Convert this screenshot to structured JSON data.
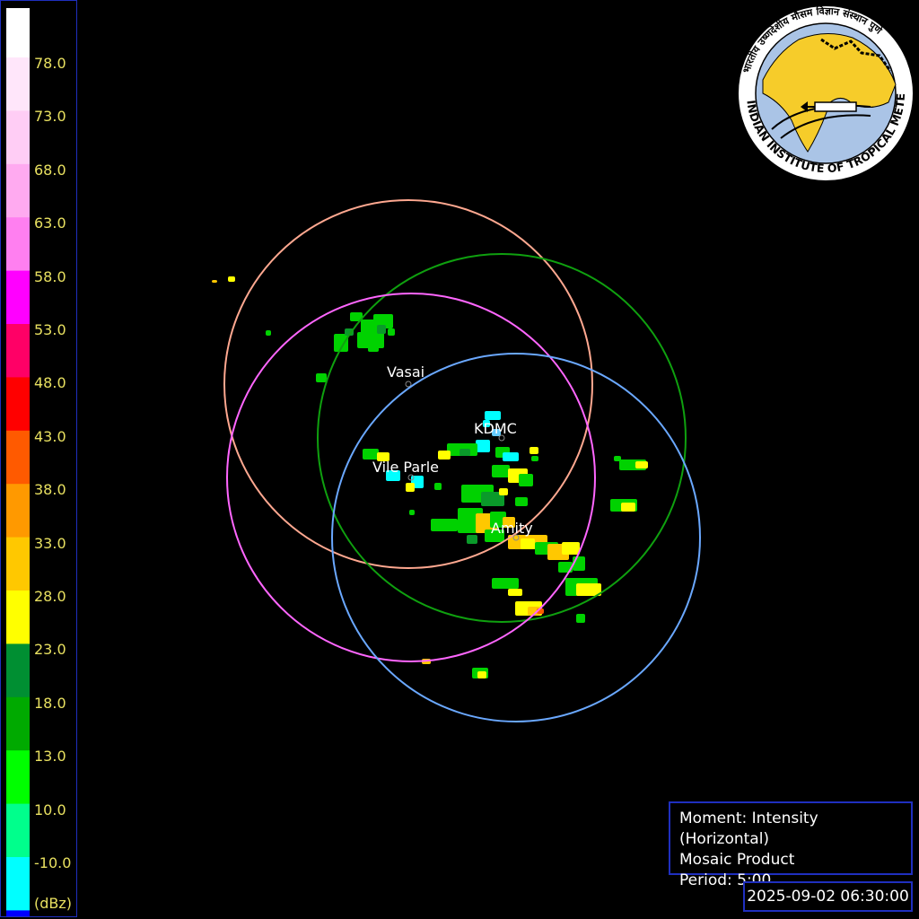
{
  "legend": {
    "unit": "(dBz)",
    "labels": [
      "78.0",
      "73.0",
      "68.0",
      "63.0",
      "58.0",
      "53.0",
      "48.0",
      "43.0",
      "38.0",
      "33.0",
      "28.0",
      "23.0",
      "18.0",
      "13.0",
      "10.0",
      "-10.0"
    ],
    "colors_top_to_bottom": [
      "#ffffff",
      "#ffe6fa",
      "#ffcdf5",
      "#ffaaf0",
      "#ff7ff0",
      "#ff00ff",
      "#ff0066",
      "#ff0000",
      "#ff5a00",
      "#ff9900",
      "#ffc800",
      "#ffff00",
      "#008f32",
      "#00aa00",
      "#00ff00",
      "#00ff8c",
      "#00ffff",
      "#0000ff"
    ]
  },
  "sites": [
    {
      "name": "Vasai",
      "color": "#ffa890"
    },
    {
      "name": "KDMC",
      "color": "#0fa00f"
    },
    {
      "name": "Vile Parle",
      "color": "#ff66ff"
    },
    {
      "name": "Amity",
      "color": "#6aa8ff"
    }
  ],
  "info": {
    "moment": "Moment: Intensity (Horizontal)",
    "product": "Mosaic Product",
    "period": "Period: 5:00"
  },
  "timestamp": "2025-09-02 06:30:00",
  "logo": {
    "text": "INDIAN INSTITUTE OF TROPICAL METEOROLOGY PUNE",
    "hindi_text": "भारतीय उष्णदेशीय मौसम विज्ञान संस्थान पुणे"
  }
}
